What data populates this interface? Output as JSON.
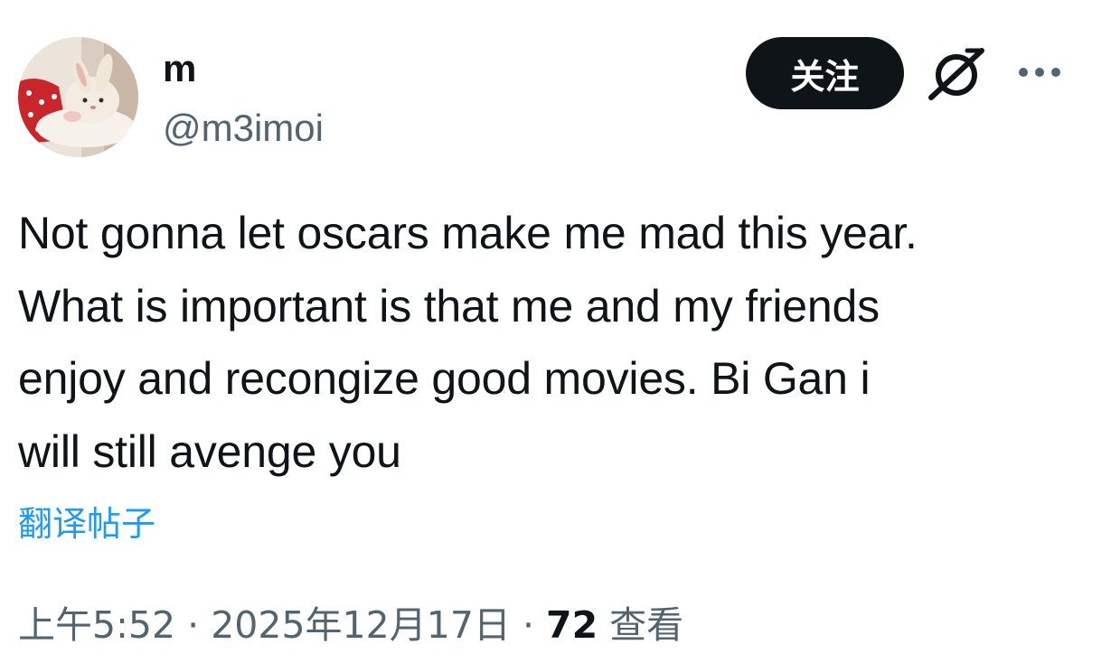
{
  "author": {
    "display_name": "m",
    "handle": "@m3imoi",
    "avatar_icon": "avatar-bunny-plush-icon"
  },
  "actions": {
    "follow_label": "关注",
    "grok_icon": "grok-icon",
    "more_icon": "more-horizontal-icon"
  },
  "tweet": {
    "text": "Not gonna let oscars make me mad this year.\nWhat is important is that me and my friends\nenjoy and recongize good movies. Bi Gan i\nwill still avenge you",
    "translate_label": "翻译帖子"
  },
  "meta": {
    "time": "上午5:52",
    "separator": "·",
    "date": "2025年12月17日",
    "views_count": "72",
    "views_label": "查看"
  },
  "colors": {
    "text_primary": "#0f1419",
    "text_secondary": "#536471",
    "link": "#1d9bf0",
    "follow_bg": "#0f1419",
    "follow_text": "#ffffff"
  }
}
